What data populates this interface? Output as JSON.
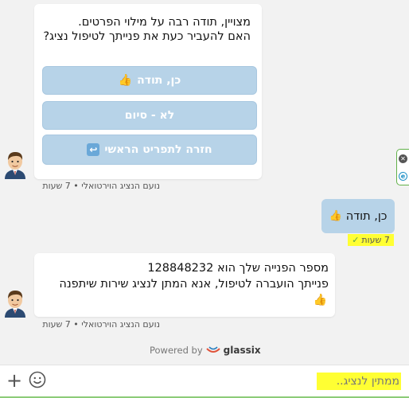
{
  "messages": {
    "bot1": {
      "text": "מצויין, תודה רבה על מילוי הפרטים.\nהאם להעביר כעת את פנייתך לטיפול נציג?",
      "buttons": [
        {
          "label": "כן, תודה",
          "emoji": "👍"
        },
        {
          "label": "לא - סיום",
          "emoji": ""
        },
        {
          "label": "חזרה לתפריט הראשי",
          "emoji": "↩"
        }
      ],
      "meta": "נועם הנציג הוירטואלי • 7 שעות"
    },
    "user1": {
      "text": "כן, תודה",
      "emoji": "👍",
      "time": "7 שעות",
      "check": "✓"
    },
    "bot2": {
      "line1": "מספר הפנייה שלך הוא 128848232",
      "line2": "פנייתך הועברה לטיפול, אנא המתן לנציג שירות שיתפנה",
      "emoji": "👍",
      "meta": "נועם הנציג הוירטואלי • 7 שעות"
    }
  },
  "footer": {
    "powered_by": "Powered by",
    "brand": "glassix"
  },
  "input": {
    "placeholder": "ממתין לנציג.."
  },
  "icons": {
    "add": "plus-icon",
    "emoji": "smiley-icon",
    "close": "close-icon",
    "side_logo": "e-logo-icon"
  },
  "colors": {
    "quick_reply_bg": "#b7d3e8",
    "highlight": "#ffff33",
    "input_border": "#8ccc78"
  }
}
